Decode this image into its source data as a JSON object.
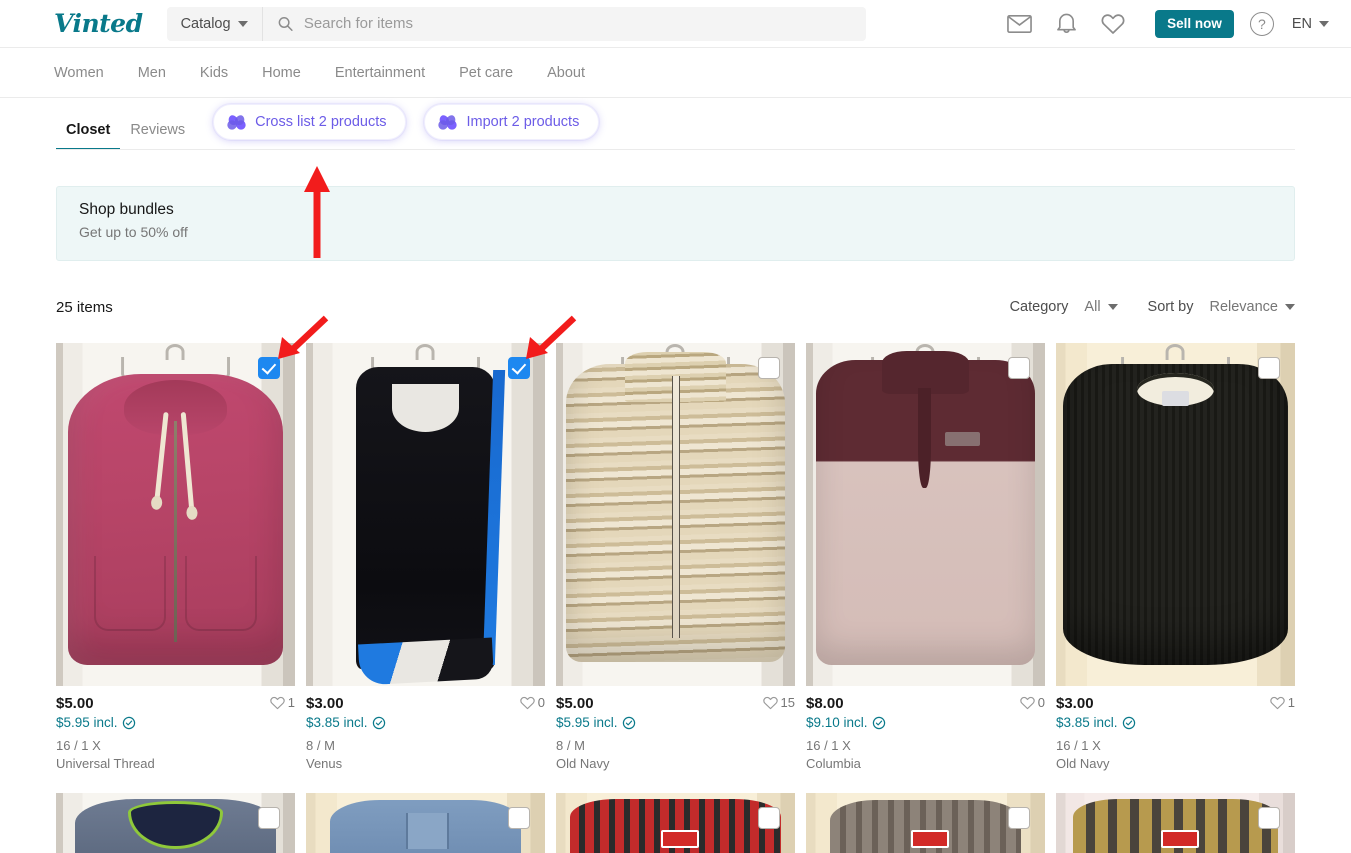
{
  "header": {
    "brand": "Vinted",
    "catalog_label": "Catalog",
    "search_placeholder": "Search for items",
    "search_value": "",
    "mail_icon": "envelope-icon",
    "bell_icon": "bell-icon",
    "heart_icon": "heart-icon",
    "sell_now_label": "Sell now",
    "help_label": "?",
    "language": "EN"
  },
  "nav": {
    "items": [
      {
        "label": "Women"
      },
      {
        "label": "Men"
      },
      {
        "label": "Kids"
      },
      {
        "label": "Home"
      },
      {
        "label": "Entertainment"
      },
      {
        "label": "Pet care"
      },
      {
        "label": "About"
      }
    ]
  },
  "tabs": {
    "items": [
      {
        "label": "Closet",
        "active": true
      },
      {
        "label": "Reviews",
        "active": false
      }
    ],
    "cross_list_label": "Cross list 2 products",
    "import_label": "Import 2 products",
    "extension_icon": "crosslist-butterfly-icon",
    "accent_color": "#6c5ce7"
  },
  "banner": {
    "title": "Shop bundles",
    "subtitle": "Get up to 50% off",
    "bg_color": "#eef7f7"
  },
  "filters": {
    "item_count": "25 items",
    "category_label": "Category",
    "category_value": "All",
    "sort_label": "Sort by",
    "sort_value": "Relevance"
  },
  "products": [
    {
      "price": "$5.00",
      "incl_price": "$5.95 incl.",
      "size": "16 / 1 X",
      "brand": "Universal Thread",
      "likes": "1",
      "selected": true,
      "art": "hoodie"
    },
    {
      "price": "$3.00",
      "incl_price": "$3.85 incl.",
      "size": "8 / M",
      "brand": "Venus",
      "likes": "0",
      "selected": true,
      "art": "tank"
    },
    {
      "price": "$5.00",
      "incl_price": "$5.95 incl.",
      "size": "8 / M",
      "brand": "Old Navy",
      "likes": "15",
      "selected": false,
      "art": "sherpa"
    },
    {
      "price": "$8.00",
      "incl_price": "$9.10 incl.",
      "size": "16 / 1 X",
      "brand": "Columbia",
      "likes": "0",
      "selected": false,
      "art": "columbia"
    },
    {
      "price": "$3.00",
      "incl_price": "$3.85 incl.",
      "size": "16 / 1 X",
      "brand": "Old Navy",
      "likes": "1",
      "selected": false,
      "art": "knit"
    }
  ],
  "products_row2": [
    {
      "selected": false,
      "art": "jersey"
    },
    {
      "selected": false,
      "art": "denim"
    },
    {
      "selected": false,
      "art": "plaid-red"
    },
    {
      "selected": false,
      "art": "plaid-gray"
    },
    {
      "selected": false,
      "art": "plaid-tan"
    }
  ],
  "annotations": {
    "arrow_color": "#f21c1c",
    "arrow_cross_list": "vertical-arrow-pointing-to-cross-list-button",
    "arrow_item_1": "diagonal-arrow-pointing-to-first-checkbox",
    "arrow_item_2": "diagonal-arrow-pointing-to-second-checkbox"
  },
  "theme": {
    "brand_color": "#09798a",
    "checkbox_checked_color": "#1e88f0",
    "text_primary": "#171717",
    "text_muted": "#767676"
  }
}
